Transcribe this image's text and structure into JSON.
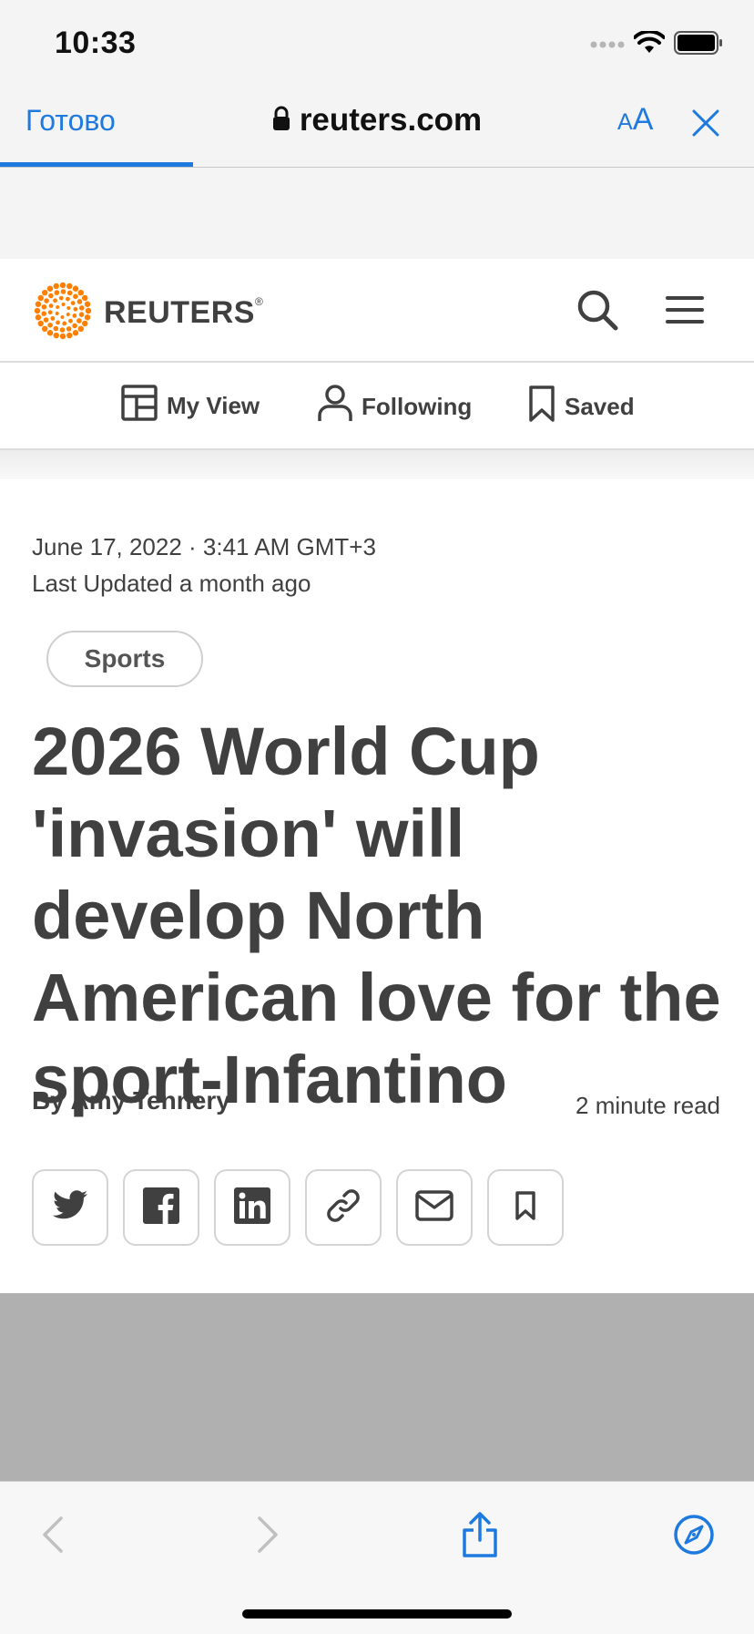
{
  "status_bar": {
    "time": "10:33"
  },
  "browser": {
    "done_label": "Готово",
    "url": "reuters.com",
    "text_size_small": "A",
    "text_size_large": "A",
    "accent_color": "#1f7ae0"
  },
  "site": {
    "brand": "REUTERS",
    "registered_mark": "®",
    "brand_color": "#ff8000",
    "nav": [
      {
        "label": "My View",
        "icon": "layout-icon"
      },
      {
        "label": "Following",
        "icon": "person-icon"
      },
      {
        "label": "Saved",
        "icon": "bookmark-icon"
      }
    ]
  },
  "article": {
    "date": "June 17, 2022 · 3:41 AM GMT+3",
    "updated": "Last Updated a month ago",
    "tag": "Sports",
    "headline": "2026 World Cup 'invasion' will develop North American love for the sport-Infantino",
    "byline": "By Amy Tennery",
    "read_time": "2 minute read",
    "share_icons": [
      "twitter-icon",
      "facebook-icon",
      "linkedin-icon",
      "link-icon",
      "mail-icon",
      "bookmark-icon"
    ]
  },
  "toolbar": {
    "icons": [
      "back-icon",
      "forward-icon",
      "share-icon",
      "compass-icon"
    ]
  }
}
